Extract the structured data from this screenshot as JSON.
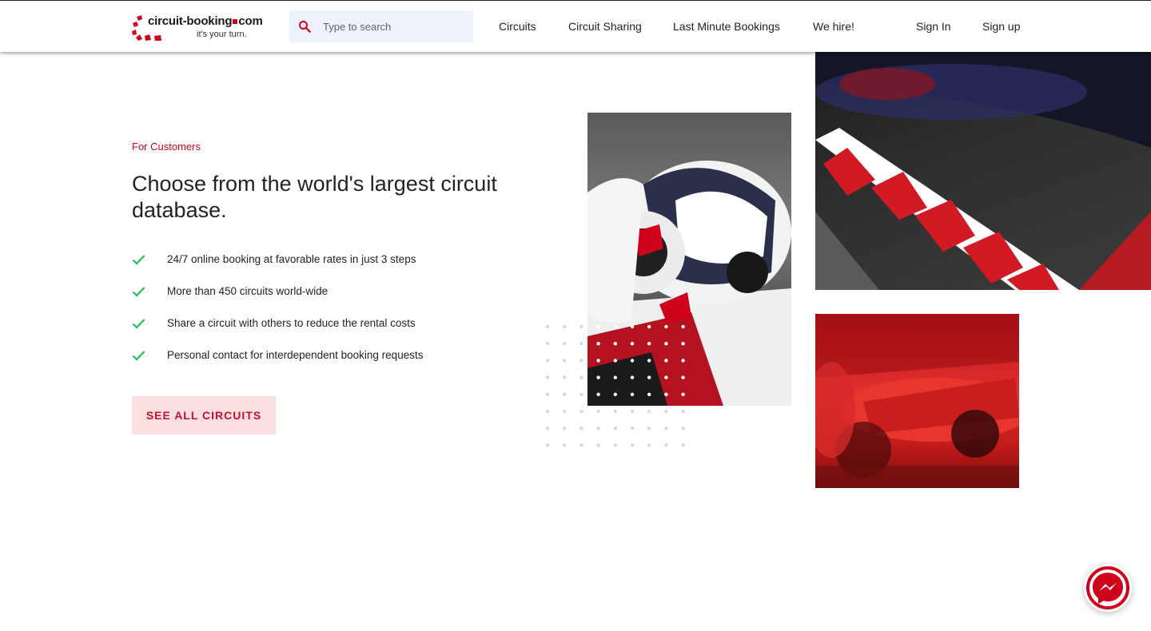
{
  "header": {
    "logo": {
      "name_part1": "circuit-booking",
      "name_part2": "com",
      "tagline": "it's your turn."
    },
    "search": {
      "placeholder": "Type to search",
      "value": ""
    },
    "nav": [
      {
        "label": "Circuits"
      },
      {
        "label": "Circuit Sharing"
      },
      {
        "label": "Last Minute Bookings"
      },
      {
        "label": "We hire!"
      }
    ],
    "auth": {
      "sign_in": "Sign In",
      "sign_up": "Sign up"
    }
  },
  "hero": {
    "eyebrow": "For Customers",
    "headline": "Choose from the world's largest circuit database.",
    "features": [
      "24/7 online booking at favorable rates in just 3 steps",
      "More than 450 circuits world-wide",
      "Share a circuit with others to reduce the rental costs",
      "Personal contact for interdependent booking requests"
    ],
    "cta_label": "SEE ALL CIRCUITS"
  },
  "images": [
    {
      "subject": "motorcycle-racer-photo"
    },
    {
      "subject": "red-white-curb-race-car-photo"
    },
    {
      "subject": "red-formula-car-pitstop-photo"
    }
  ],
  "colors": {
    "brand_red": "#d0021b",
    "cta_background": "#fbe0e2",
    "check_green": "#2dba4e",
    "search_background": "#eef3fb"
  },
  "icons": {
    "search": "search-icon",
    "check": "check-icon",
    "chat": "messenger-icon"
  }
}
